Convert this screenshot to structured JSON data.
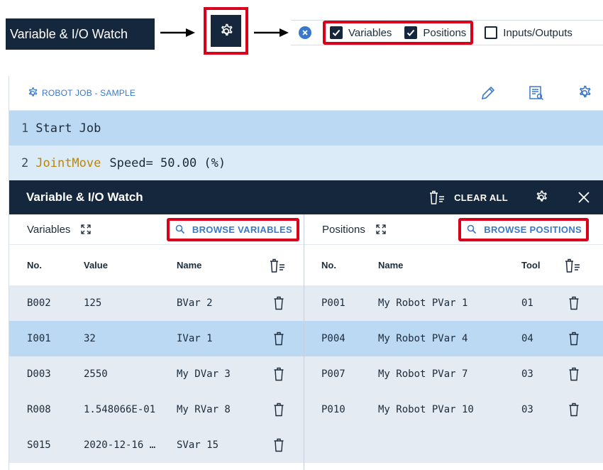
{
  "strip": {
    "title": "Variable & I/O Watch",
    "filters": [
      {
        "label": "Variables",
        "checked": true
      },
      {
        "label": "Positions",
        "checked": true
      },
      {
        "label": "Inputs/Outputs",
        "checked": false
      }
    ]
  },
  "job": {
    "title": "ROBOT JOB - SAMPLE",
    "icons": [
      "gear-icon",
      "pencil-icon",
      "document-search-icon",
      "gear-icon"
    ],
    "lines": [
      {
        "num": "1",
        "keyword": "",
        "text": "Start Job"
      },
      {
        "num": "2",
        "keyword": "JointMove",
        "text": "Speed= 50.00 (%)"
      }
    ]
  },
  "watch": {
    "title": "Variable & I/O Watch",
    "clear_all": "CLEAR ALL",
    "variables": {
      "label": "Variables",
      "browse": "BROWSE VARIABLES",
      "columns": {
        "no": "No.",
        "value": "Value",
        "name": "Name"
      },
      "rows": [
        {
          "no": "B002",
          "value": "125",
          "name": "BVar 2"
        },
        {
          "no": "I001",
          "value": "32",
          "name": "IVar 1"
        },
        {
          "no": "D003",
          "value": "2550",
          "name": "My DVar 3"
        },
        {
          "no": "R008",
          "value": "1.548066E-01",
          "name": "My RVar 8"
        },
        {
          "no": "S015",
          "value": "2020-12-16 …",
          "name": "SVar 15"
        }
      ]
    },
    "positions": {
      "label": "Positions",
      "browse": "BROWSE POSITIONS",
      "columns": {
        "no": "No.",
        "name": "Name",
        "tool": "Tool"
      },
      "rows": [
        {
          "no": "P001",
          "name": "My Robot PVar 1",
          "tool": "01"
        },
        {
          "no": "P004",
          "name": "My Robot PVar 4",
          "tool": "04"
        },
        {
          "no": "P007",
          "name": "My Robot PVar 7",
          "tool": "03"
        },
        {
          "no": "P010",
          "name": "My Robot PVar 10",
          "tool": "03"
        }
      ]
    }
  },
  "colors": {
    "navy": "#14273c",
    "accent_blue": "#3a78c9",
    "highlight_red": "#d9001b",
    "selected_row": "#bcd9f4",
    "alt_row": "#e4ebf3"
  }
}
